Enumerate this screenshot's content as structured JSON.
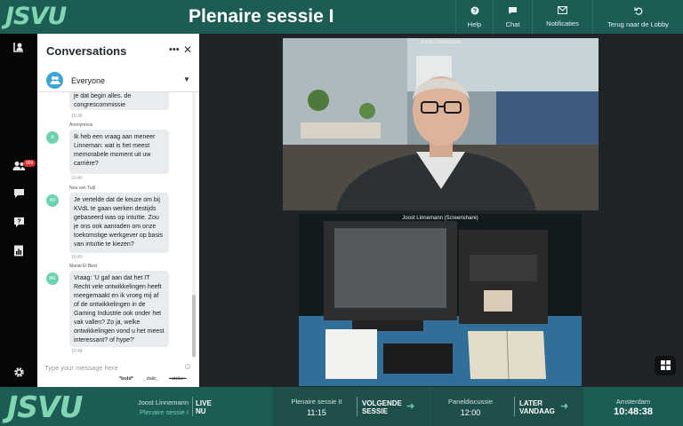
{
  "app": {
    "logo": "JSVU",
    "title": "Plenaire sessie I"
  },
  "topnav": [
    {
      "label": "Help",
      "icon": "help-icon"
    },
    {
      "label": "Chat",
      "icon": "chat-icon"
    },
    {
      "label": "Notificaties",
      "icon": "mail-icon"
    },
    {
      "label": "Terug naar de Lobby",
      "icon": "back-icon"
    }
  ],
  "sidebar": {
    "badge": "999"
  },
  "chat": {
    "title": "Conversations",
    "audience": "Everyone",
    "messages": [
      {
        "author": "",
        "initials": "",
        "text": "je dat begin alles. de congrescommissie",
        "time": "10:36"
      },
      {
        "author": "Anonymous",
        "initials": "A",
        "text": "Ik heb een vraag aan meneer Linneman: wat is het meest memorabele moment uit uw carrière?",
        "time": "10:40"
      },
      {
        "author": "Noa van Tuijl",
        "initials": "NV",
        "text": "Je vertelde dat de keuze om bij KVdL te gaan werken destijds gebaseerd was op intuïtie. Zou je ons ook aanraden om onze toekomstige werkgever op basis van intuïtie te kiezen?",
        "time": "10:43"
      },
      {
        "author": "Manal El Bied",
        "initials": "ME",
        "text": "Vraag: 'U gaf aan dat het IT Recht vele ontwikkelingen heeft meegemaakt en ik vroeg mij af of de ontwikkelingen in de Gaming Industrie ook onder het vak vallen? Zo ja, welke ontwikkelingen vond u het meest interessant? of hype?'",
        "time": "10:48"
      }
    ],
    "input_placeholder": "Type your message here",
    "format_bold": "*bold*",
    "format_italic": "_italic_",
    "format_strike": "~strike~"
  },
  "videos": [
    {
      "label": "Joost Linnemann"
    },
    {
      "label": "Joost Linnemann (Screenshare)"
    }
  ],
  "schedule": {
    "now": {
      "speaker": "Joost Linnemann",
      "session": "Plenaire sessie I",
      "tag_line1": "LIVE",
      "tag_line2": "NU"
    },
    "next": {
      "session": "Plenaire sessie II",
      "time": "11:15",
      "tag_line1": "VOLGENDE",
      "tag_line2": "SESSIE"
    },
    "later": {
      "session": "Paneldiscussie",
      "time": "12:00",
      "tag_line1": "LATER",
      "tag_line2": "VANDAAG"
    },
    "clock": {
      "city": "Amsterdam",
      "time": "10:48:38"
    }
  }
}
